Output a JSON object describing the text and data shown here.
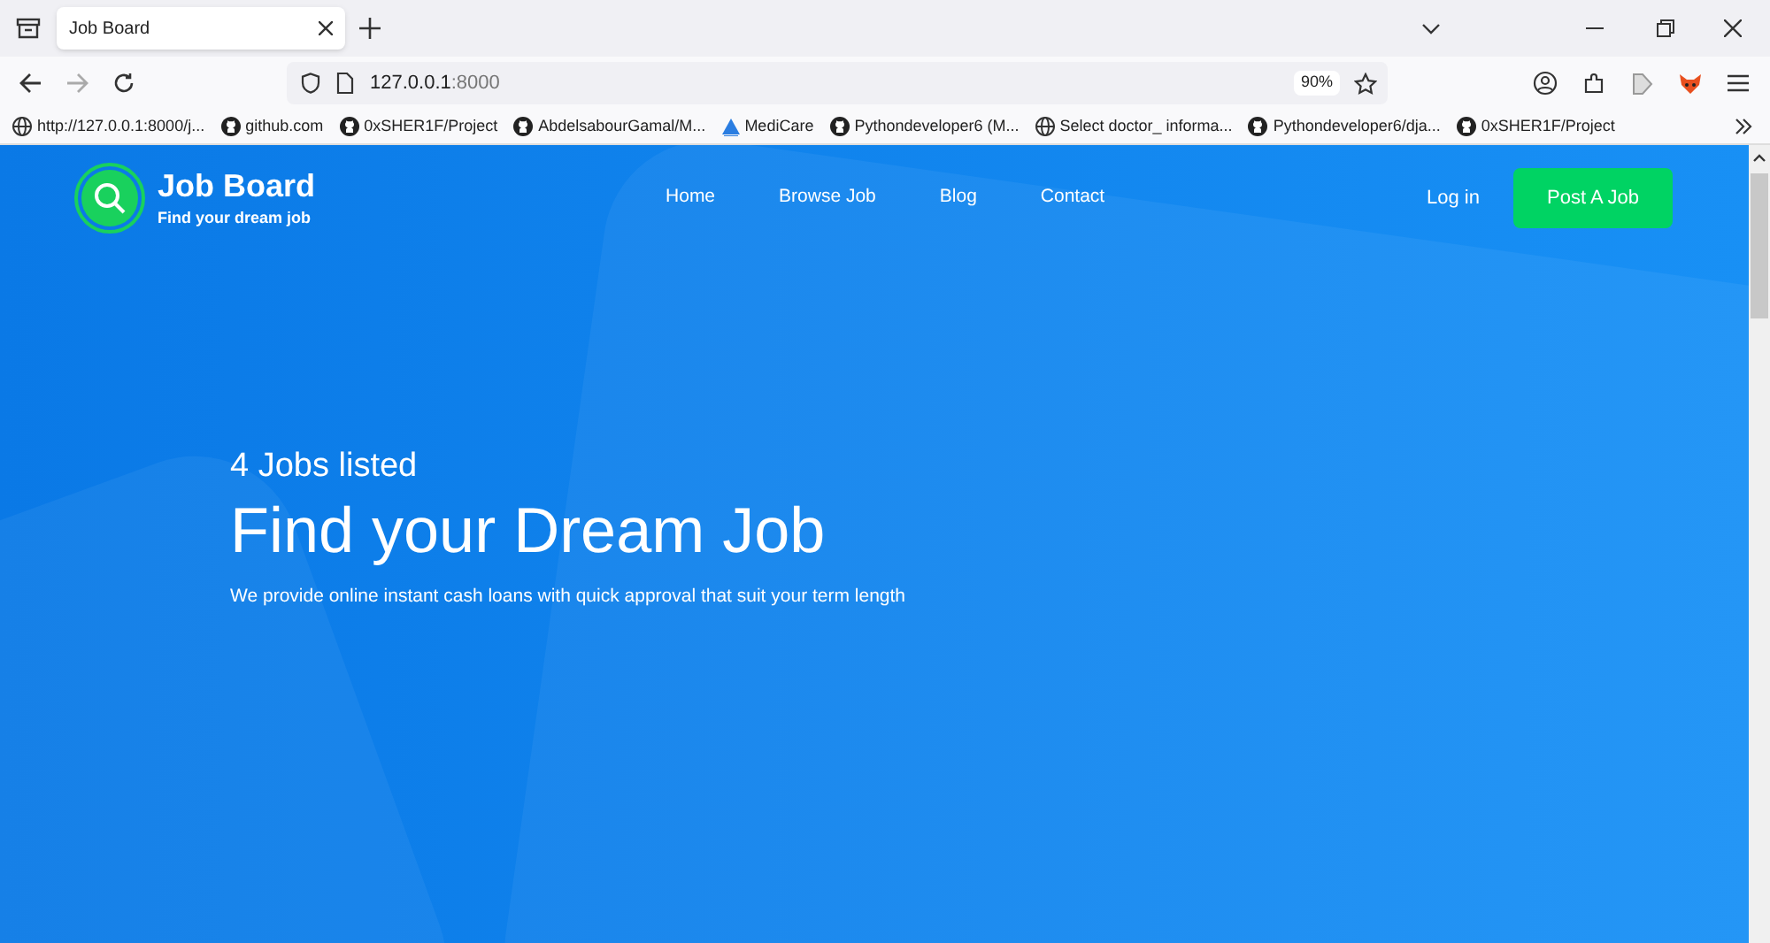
{
  "browser": {
    "tabs": [
      {
        "title": "Job Board",
        "selected": true
      }
    ],
    "url_host": "127.0.0.1",
    "url_port": ":8000",
    "zoom": "90%",
    "bookmarks": [
      {
        "kind": "globe",
        "label": "http://127.0.0.1:8000/j..."
      },
      {
        "kind": "github",
        "label": "github.com"
      },
      {
        "kind": "github",
        "label": "0xSHER1F/Project"
      },
      {
        "kind": "github",
        "label": "AbdelsabourGamal/M..."
      },
      {
        "kind": "medicare",
        "label": "MediCare"
      },
      {
        "kind": "github",
        "label": "Pythondeveloper6 (M..."
      },
      {
        "kind": "globe",
        "label": "Select doctor_ informa..."
      },
      {
        "kind": "github",
        "label": "Pythondeveloper6/dja..."
      },
      {
        "kind": "github",
        "label": "0xSHER1F/Project"
      }
    ]
  },
  "site": {
    "logo_title": "Job Board",
    "logo_subtitle": "Find your dream job",
    "nav": [
      {
        "label": "Home"
      },
      {
        "label": "Browse Job"
      },
      {
        "label": "Blog"
      },
      {
        "label": "Contact"
      }
    ],
    "login": "Log in",
    "post_button": "Post A Job"
  },
  "hero": {
    "count": "4 Jobs listed",
    "title": "Find your Dream Job",
    "subtitle": "We provide online instant cash loans with quick approval that suit your term length"
  }
}
